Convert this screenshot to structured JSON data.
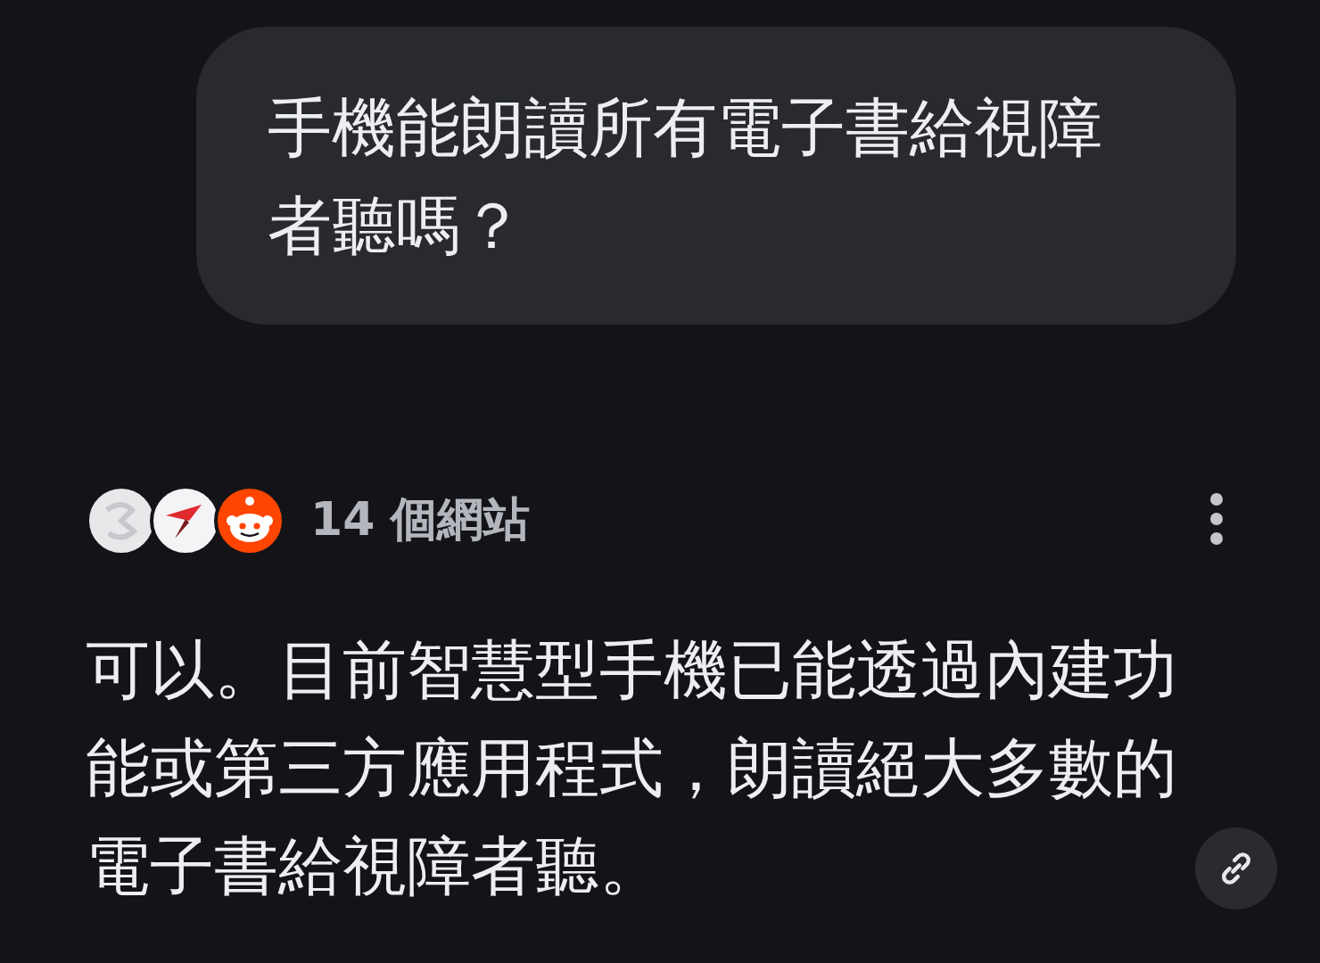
{
  "question": {
    "text": "手機能朗讀所有電子書給視障者聽嗎？"
  },
  "sources": {
    "count": "14 個網站"
  },
  "answer": {
    "text": "可以。目前智慧型手機已能透過內建功能或第三方應用程式，朗讀絕大多數的電子書給視障者聽。"
  }
}
